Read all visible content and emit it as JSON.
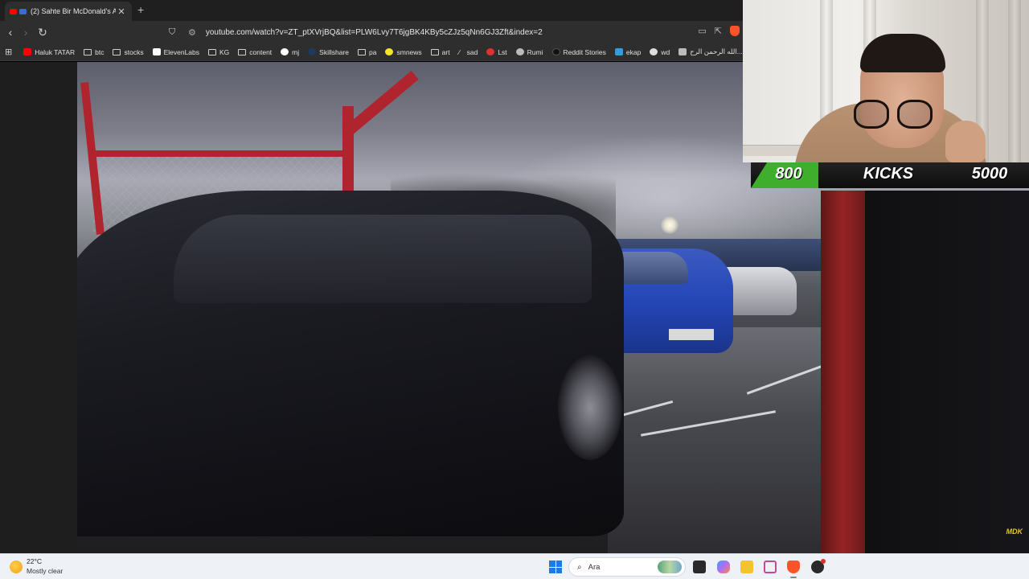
{
  "browser": {
    "tab": {
      "title": "(2) Sahte Bir McDonald's Ara"
    },
    "new_tab_symbol": "+",
    "close_symbol": "✕",
    "url": "youtube.com/watch?v=ZT_ptXVrjBQ&list=PLW6Lvy7T6jgBK4KBy5cZJz5qNn6GJ3Zft&index=2"
  },
  "bookmarks": [
    {
      "label": "Haluk TATAR",
      "icon": "youtube-icon"
    },
    {
      "label": "btc",
      "icon": "folder-icon"
    },
    {
      "label": "stocks",
      "icon": "folder-icon"
    },
    {
      "label": "ElevenLabs",
      "icon": "elevenlabs-icon"
    },
    {
      "label": "KG",
      "icon": "folder-icon"
    },
    {
      "label": "content",
      "icon": "folder-icon"
    },
    {
      "label": "mj",
      "icon": "github-icon"
    },
    {
      "label": "Skillshare",
      "icon": "skillshare-icon"
    },
    {
      "label": "pa",
      "icon": "folder-icon"
    },
    {
      "label": "smnews",
      "icon": "smiley-icon"
    },
    {
      "label": "art",
      "icon": "folder-icon"
    },
    {
      "label": "sad",
      "icon": "feather-icon"
    },
    {
      "label": "Lst",
      "icon": "s-icon"
    },
    {
      "label": "Rumi",
      "icon": "globe-icon"
    },
    {
      "label": "Reddit Stories",
      "icon": "reddit-icon"
    },
    {
      "label": "ekap",
      "icon": "ekap-icon"
    },
    {
      "label": "wd",
      "icon": "wd-icon"
    },
    {
      "label": "الله الرحمن الرح...",
      "icon": "arabic-icon"
    }
  ],
  "overlay": {
    "score_left": "800",
    "score_label": "KICKS",
    "score_right": "5000",
    "accent": "#3fae2c"
  },
  "watermark": "MDK",
  "taskbar": {
    "weather_temp": "22°C",
    "weather_desc": "Mostly clear",
    "search_placeholder": "Ara",
    "accent": "#1f7ae0"
  }
}
